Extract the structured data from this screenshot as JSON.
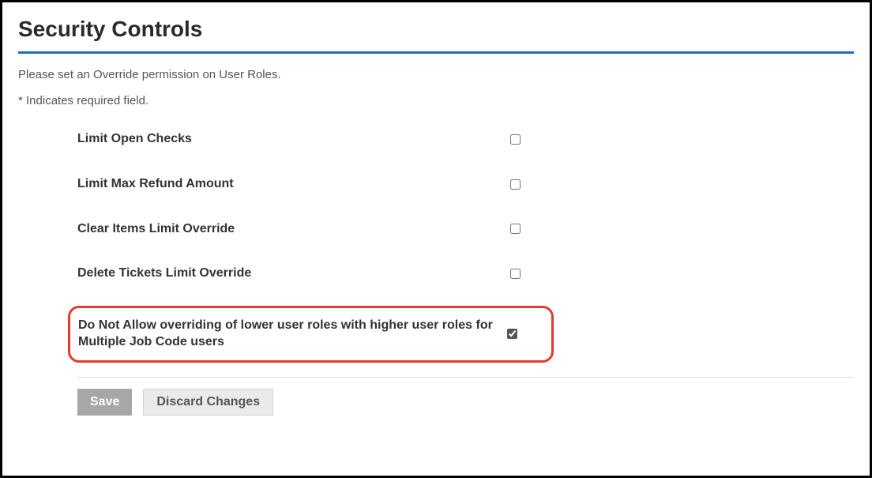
{
  "title": "Security Controls",
  "intro": "Please set an Override permission on User Roles.",
  "required_note": "* Indicates required field.",
  "controls": [
    {
      "label": "Limit Open Checks",
      "checked": false,
      "highlight": false
    },
    {
      "label": "Limit Max Refund Amount",
      "checked": false,
      "highlight": false
    },
    {
      "label": "Clear Items Limit Override",
      "checked": false,
      "highlight": false
    },
    {
      "label": "Delete Tickets Limit Override",
      "checked": false,
      "highlight": false
    },
    {
      "label": "Do Not Allow overriding of lower user roles with higher user roles for Multiple Job Code users",
      "checked": true,
      "highlight": true
    }
  ],
  "buttons": {
    "save": "Save",
    "discard": "Discard Changes"
  },
  "colors": {
    "accent": "#1b6ec2",
    "highlight_border": "#e23b2e"
  }
}
